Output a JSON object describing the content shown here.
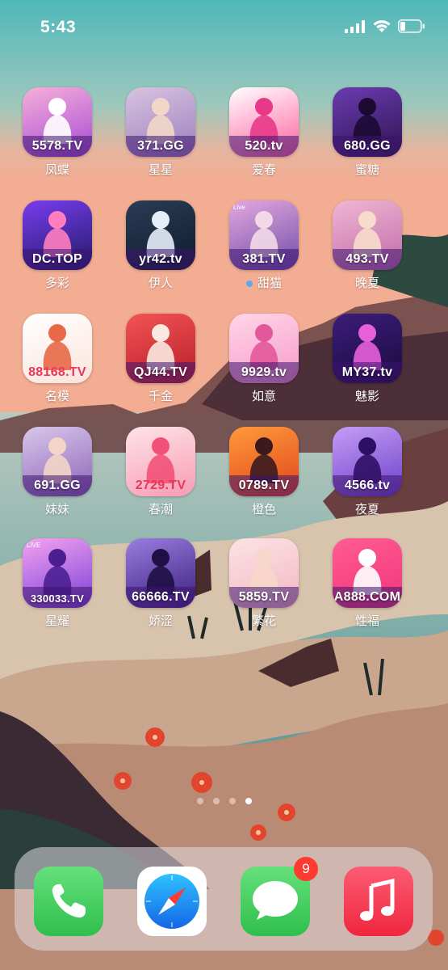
{
  "status_bar": {
    "time": "5:43"
  },
  "apps": [
    {
      "label": "凤蝶",
      "domain": "5578.TV",
      "icon": "butterfly-logo-icon",
      "bg": [
        "#f6b0d8",
        "#a64ad6"
      ],
      "figure": "#ffffff"
    },
    {
      "label": "星星",
      "domain": "371.GG",
      "icon": "portrait-woman-icon",
      "bg": [
        "#d7c3e0",
        "#9d7fbe"
      ],
      "figure": "#f2d7c8"
    },
    {
      "label": "爱春",
      "domain": "520.tv",
      "icon": "chun-character-icon",
      "bg": [
        "#ffffff",
        "#ff5f9e"
      ],
      "figure": "#e8388a"
    },
    {
      "label": "蜜糖",
      "domain": "680.GG",
      "icon": "moon-silhouette-icon",
      "bg": [
        "#6b3cb0",
        "#2e1452"
      ],
      "figure": "#1c0a33"
    },
    {
      "label": "多彩",
      "domain": "DC.TOP",
      "icon": "colorful-woman-icon",
      "bg": [
        "#7a3cf0",
        "#1f1b66"
      ],
      "figure": "#ff7ec0"
    },
    {
      "label": "伊人",
      "domain": "yr42.tv",
      "icon": "yi-character-icon",
      "bg": [
        "#2a3c55",
        "#0f1b2e"
      ],
      "figure": "#e5eef7"
    },
    {
      "label": "甜猫",
      "domain": "381.TV",
      "icon": "cat-girl-icon",
      "bg": [
        "#e4a7e0",
        "#6d4ea6"
      ],
      "figure": "#f3d9e8",
      "live": "Live",
      "dot": true
    },
    {
      "label": "晚夏",
      "domain": "493.TV",
      "icon": "summer-woman-icon",
      "bg": [
        "#f0b7d4",
        "#c06aa8"
      ],
      "figure": "#f7dccb"
    },
    {
      "label": "名模",
      "domain": "88168.TV",
      "icon": "model-profile-icon",
      "bg": [
        "#ffffff",
        "#fbe4dc"
      ],
      "figure": "#e86848",
      "dark": true
    },
    {
      "label": "千金",
      "domain": "QJ44.TV",
      "icon": "lady-umbrella-icon",
      "bg": [
        "#f25454",
        "#b81e2a"
      ],
      "figure": "#fbe8e0"
    },
    {
      "label": "如意",
      "domain": "9929.tv",
      "icon": "pink-silhouette-icon",
      "bg": [
        "#ffd6e8",
        "#f79ac8"
      ],
      "figure": "#e2589a"
    },
    {
      "label": "魅影",
      "domain": "MY37.tv",
      "icon": "m-letter-icon",
      "bg": [
        "#3b1d7a",
        "#1b0b3e"
      ],
      "figure": "#e660d8"
    },
    {
      "label": "妹妹",
      "domain": "691.GG",
      "icon": "girl-portrait-icon",
      "bg": [
        "#d9c7ea",
        "#8c63b8"
      ],
      "figure": "#f2d5c6"
    },
    {
      "label": "春潮",
      "domain": "2729.TV",
      "icon": "dancer-icon",
      "bg": [
        "#ffe3e8",
        "#f79bb4"
      ],
      "figure": "#f25277",
      "dark": true
    },
    {
      "label": "橙色",
      "domain": "0789.TV",
      "icon": "qipao-woman-icon",
      "bg": [
        "#ff9a3c",
        "#e0451b"
      ],
      "figure": "#3a1a1f"
    },
    {
      "label": "夜夏",
      "domain": "4566.tv",
      "icon": "night-silhouette-icon",
      "bg": [
        "#c59df5",
        "#6d3fc9"
      ],
      "figure": "#2d1064"
    },
    {
      "label": "星耀",
      "domain": "330033.TV",
      "icon": "star-woman-icon",
      "bg": [
        "#f3a3f0",
        "#7b3fd6"
      ],
      "figure": "#4b1f91",
      "live": "LIVE"
    },
    {
      "label": "娇涩",
      "domain": "66666.TV",
      "icon": "shy-silhouette-icon",
      "bg": [
        "#9a7de0",
        "#3a1f7e"
      ],
      "figure": "#1e0f45"
    },
    {
      "label": "繁花",
      "domain": "5859.TV",
      "icon": "flower-woman-icon",
      "bg": [
        "#fbe3e6",
        "#f3b7c2"
      ],
      "figure": "#f7d7c9"
    },
    {
      "label": "性福",
      "domain": "A888.COM",
      "icon": "x-logo-icon",
      "bg": [
        "#ff5c92",
        "#f0357a"
      ],
      "figure": "#ffffff"
    }
  ],
  "dock": {
    "phone": {
      "icon": "phone-icon"
    },
    "safari": {
      "icon": "safari-compass-icon"
    },
    "messages": {
      "icon": "messages-bubble-icon",
      "badge": "9"
    },
    "music": {
      "icon": "music-note-icon"
    }
  },
  "colors": {
    "phone": "#34c759",
    "messages": "#34c759",
    "music": "#fa2d48",
    "safari": "#1a8cf7"
  },
  "pager": {
    "pages": 4,
    "current": 4
  }
}
